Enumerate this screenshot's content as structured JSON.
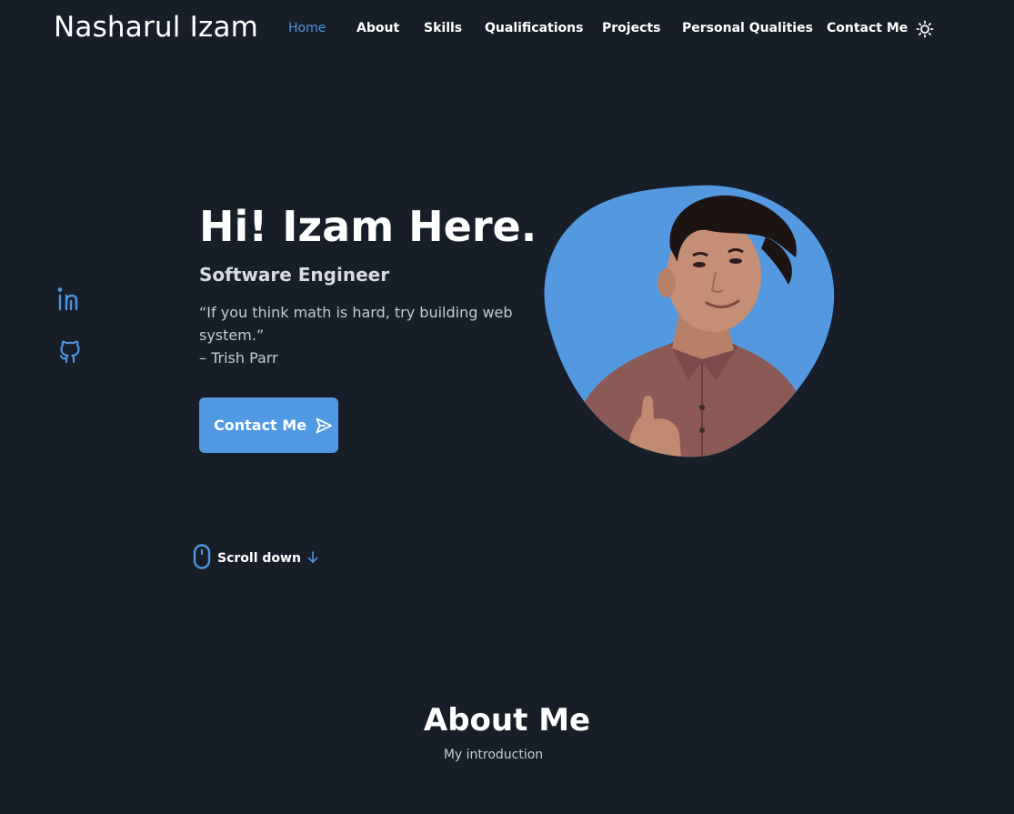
{
  "header": {
    "logo": "Nasharul Izam",
    "nav": [
      {
        "label": "Home",
        "active": true
      },
      {
        "label": "About",
        "active": false
      },
      {
        "label": "Skills",
        "active": false
      },
      {
        "label": "Qualifications",
        "active": false
      },
      {
        "label": "Projects",
        "active": false
      },
      {
        "label": "Personal Qualities",
        "active": false
      },
      {
        "label": "Contact Me",
        "active": false
      }
    ],
    "theme_icon": "sun-icon"
  },
  "social": [
    {
      "icon": "linkedin-icon"
    },
    {
      "icon": "github-icon"
    }
  ],
  "hero": {
    "title": "Hi! Izam Here.",
    "subtitle": "Software Engineer",
    "quote": "“If you think math is hard, try building web system.”",
    "author": "– Trish Parr",
    "button_label": "Contact Me",
    "button_icon": "send-icon"
  },
  "scroll": {
    "label": "Scroll down",
    "icon": "mouse-icon",
    "arrow_icon": "arrow-down-icon"
  },
  "about": {
    "title": "About Me",
    "subtitle": "My introduction"
  },
  "colors": {
    "background": "#171e28",
    "accent": "#4f95e0",
    "button": "#5199e2",
    "text": "#ffffff",
    "muted": "#c6ccd5"
  }
}
